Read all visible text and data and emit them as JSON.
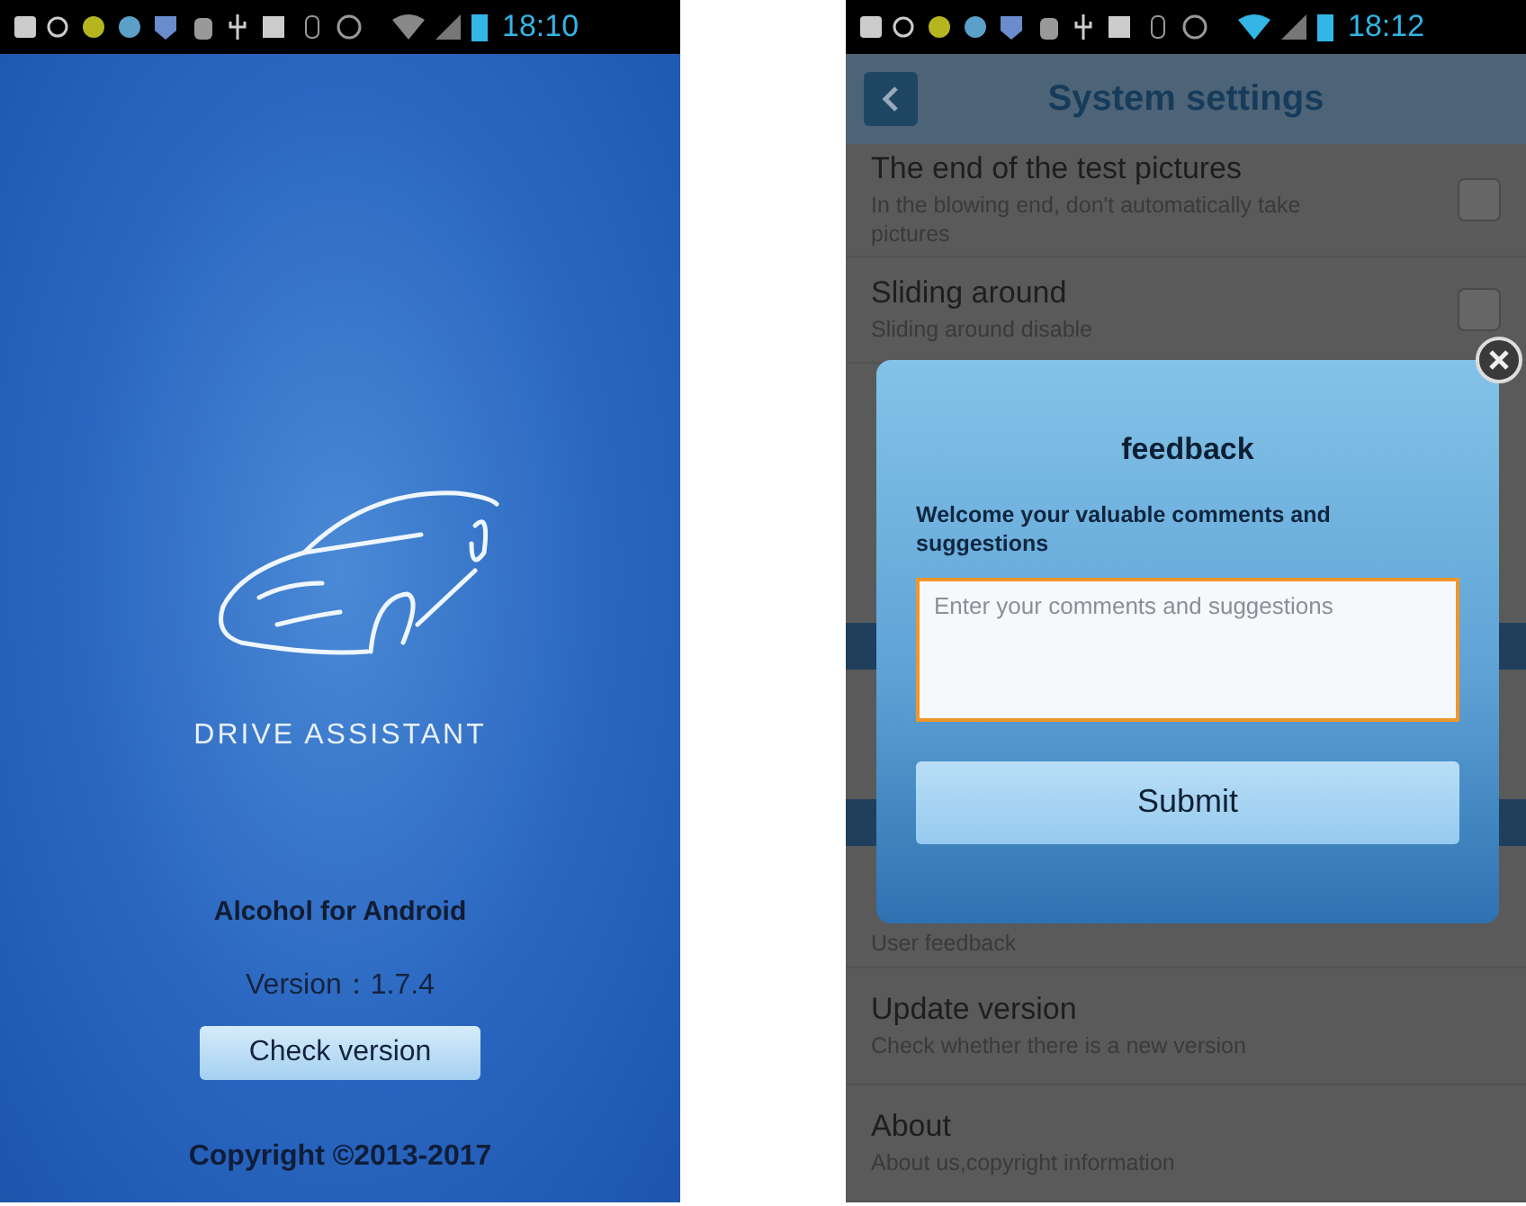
{
  "splash": {
    "status_bar": {
      "time": "18:10"
    },
    "logo_text": "DRIVE ASSISTANT",
    "app_name": "Alcohol for Android",
    "version": "Version：1.7.4",
    "check_button": "Check version",
    "copyright": "Copyright ©2013-2017"
  },
  "settings": {
    "status_bar": {
      "time": "18:12"
    },
    "title": "System settings",
    "items": [
      {
        "kind": "check",
        "title": "The end of the test pictures",
        "subtitle": "In the blowing end, don't automatically take pictures",
        "checked": false
      },
      {
        "kind": "check",
        "title": "Sliding around",
        "subtitle": "Sliding around disable",
        "checked": false
      },
      {
        "kind": "covered"
      },
      {
        "kind": "covered"
      },
      {
        "kind": "section"
      },
      {
        "kind": "covered"
      },
      {
        "kind": "section"
      },
      {
        "kind": "plain",
        "subtitle": "User feedback"
      },
      {
        "kind": "plain",
        "title": "Update version",
        "subtitle": "Check whether there is a new version"
      },
      {
        "kind": "plain",
        "title": "About",
        "subtitle": "About us,copyright information"
      }
    ]
  },
  "dialog": {
    "title": "feedback",
    "message": "Welcome your valuable comments and suggestions",
    "placeholder": "Enter your comments and suggestions",
    "submit": "Submit"
  }
}
